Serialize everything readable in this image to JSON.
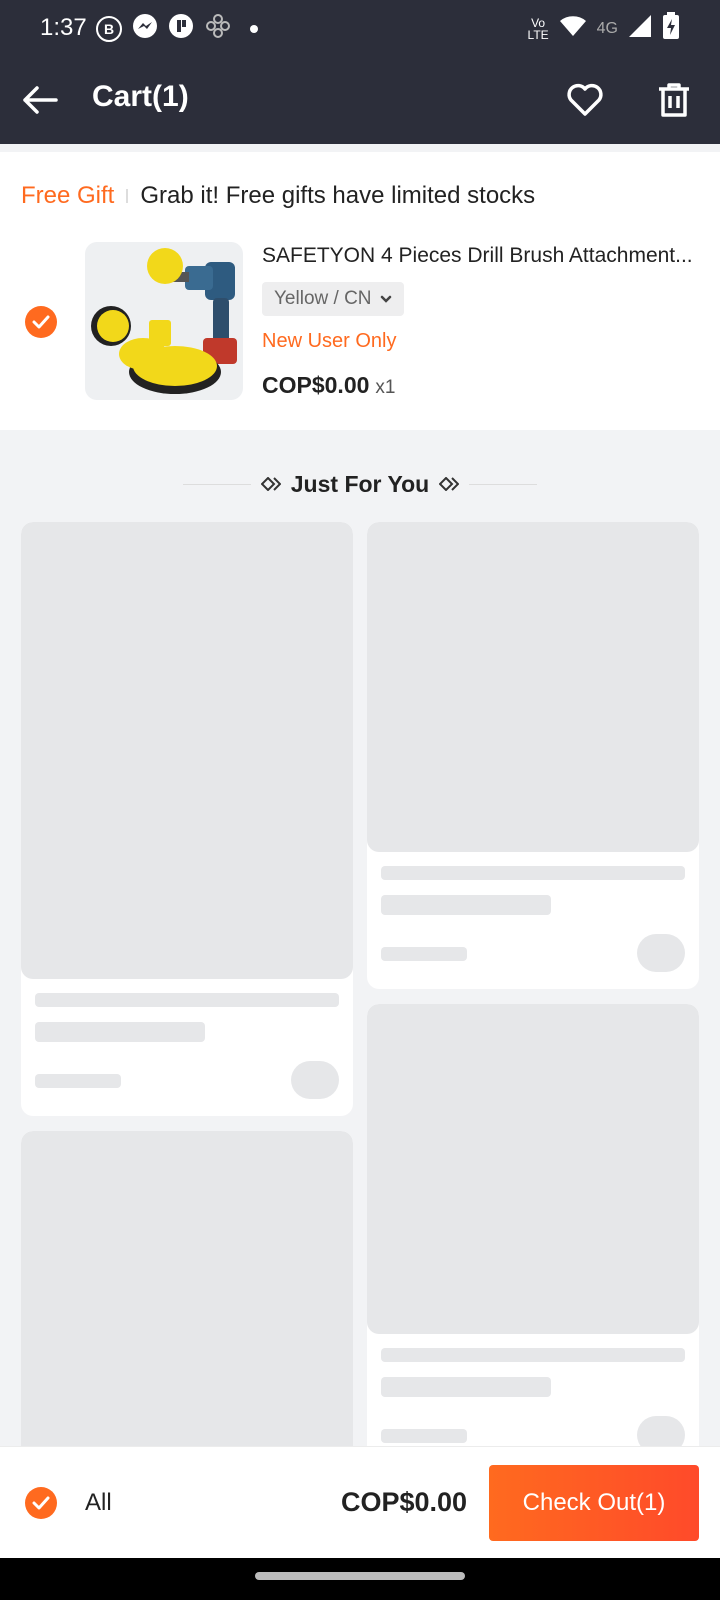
{
  "status_bar": {
    "time": "1:37",
    "left_icons": [
      "b-icon",
      "messenger-icon",
      "app-icon",
      "gamepad-icon"
    ],
    "network_top": "Vo",
    "network_bottom": "LTE",
    "network_type": "4G"
  },
  "header": {
    "title": "Cart(1)"
  },
  "free_gift": {
    "tag": "Free Gift",
    "message": "Grab it! Free gifts have limited stocks",
    "product": {
      "title": "SAFETYON 4 Pieces Drill Brush Attachment...",
      "variant": "Yellow / CN",
      "badge": "New User Only",
      "price": "COP$0.00",
      "quantity": "x1"
    }
  },
  "just_for_you": {
    "title": "Just For You"
  },
  "bottom": {
    "all_label": "All",
    "total": "COP$0.00",
    "checkout_label": "Check Out(1)"
  },
  "colors": {
    "accent": "#ff6a1f",
    "header_bg": "#2c2e3a",
    "skeleton": "#e6e7e9"
  }
}
